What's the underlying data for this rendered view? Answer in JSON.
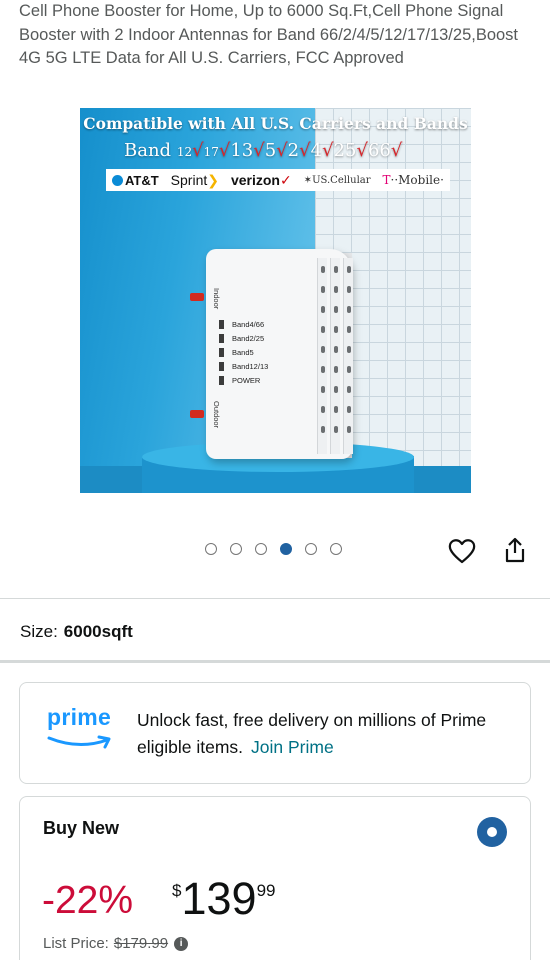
{
  "product": {
    "title": "Cell Phone Booster for Home, Up to 6000 Sq.Ft,Cell Phone Signal Booster with 2 Indoor Antennas for Band 66/2/4/5/12/17/13/25,Boost 4G 5G LTE Data for All U.S. Carriers, FCC Approved"
  },
  "image": {
    "banner": "Compatible with All U.S. Carriers and Bands",
    "bands_label": "Band",
    "bands": [
      "12",
      "17",
      "13",
      "5",
      "2",
      "4",
      "25",
      "66"
    ],
    "carriers": [
      "AT&T",
      "Sprint",
      "verizon",
      "US.Cellular",
      "T",
      "Mobile"
    ],
    "device_labels": {
      "indoor": "Indoor",
      "outdoor": "Outdoor",
      "leds": [
        "Band4/66",
        "Band2/25",
        "Band5",
        "Band12/13",
        "POWER"
      ]
    }
  },
  "gallery": {
    "total_images": 6,
    "active_index": 3
  },
  "size": {
    "label": "Size:",
    "value": "6000sqft"
  },
  "prime": {
    "logo": "prime",
    "message": "Unlock fast, free delivery on millions of Prime eligible items.",
    "link": "Join Prime"
  },
  "buy": {
    "title": "Buy New",
    "discount": "-22%",
    "currency": "$",
    "price_whole": "139",
    "price_fraction": "99",
    "list_price_label": "List Price:",
    "list_price": "$179.99"
  },
  "colors": {
    "accent_blue": "#2162a1",
    "prime_blue": "#1a98ff",
    "link_teal": "#007185",
    "deal_red": "#cc0c39"
  }
}
